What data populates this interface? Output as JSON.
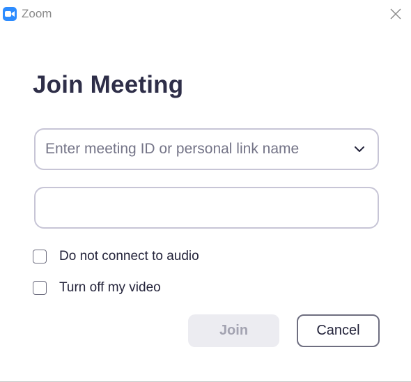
{
  "window": {
    "app_title": "Zoom",
    "logo_icon": "zoom-camera-icon",
    "close_icon": "close-icon",
    "accent_color": "#2d8cff"
  },
  "dialog": {
    "heading": "Join Meeting",
    "meeting_id": {
      "value": "",
      "placeholder": "Enter meeting ID or personal link name",
      "dropdown_icon": "chevron-down-icon"
    },
    "display_name": {
      "value": "",
      "placeholder": ""
    },
    "options": [
      {
        "label": "Do not connect to audio",
        "checked": false
      },
      {
        "label": "Turn off my video",
        "checked": false
      }
    ],
    "join_label": "Join",
    "join_enabled": false,
    "cancel_label": "Cancel"
  }
}
